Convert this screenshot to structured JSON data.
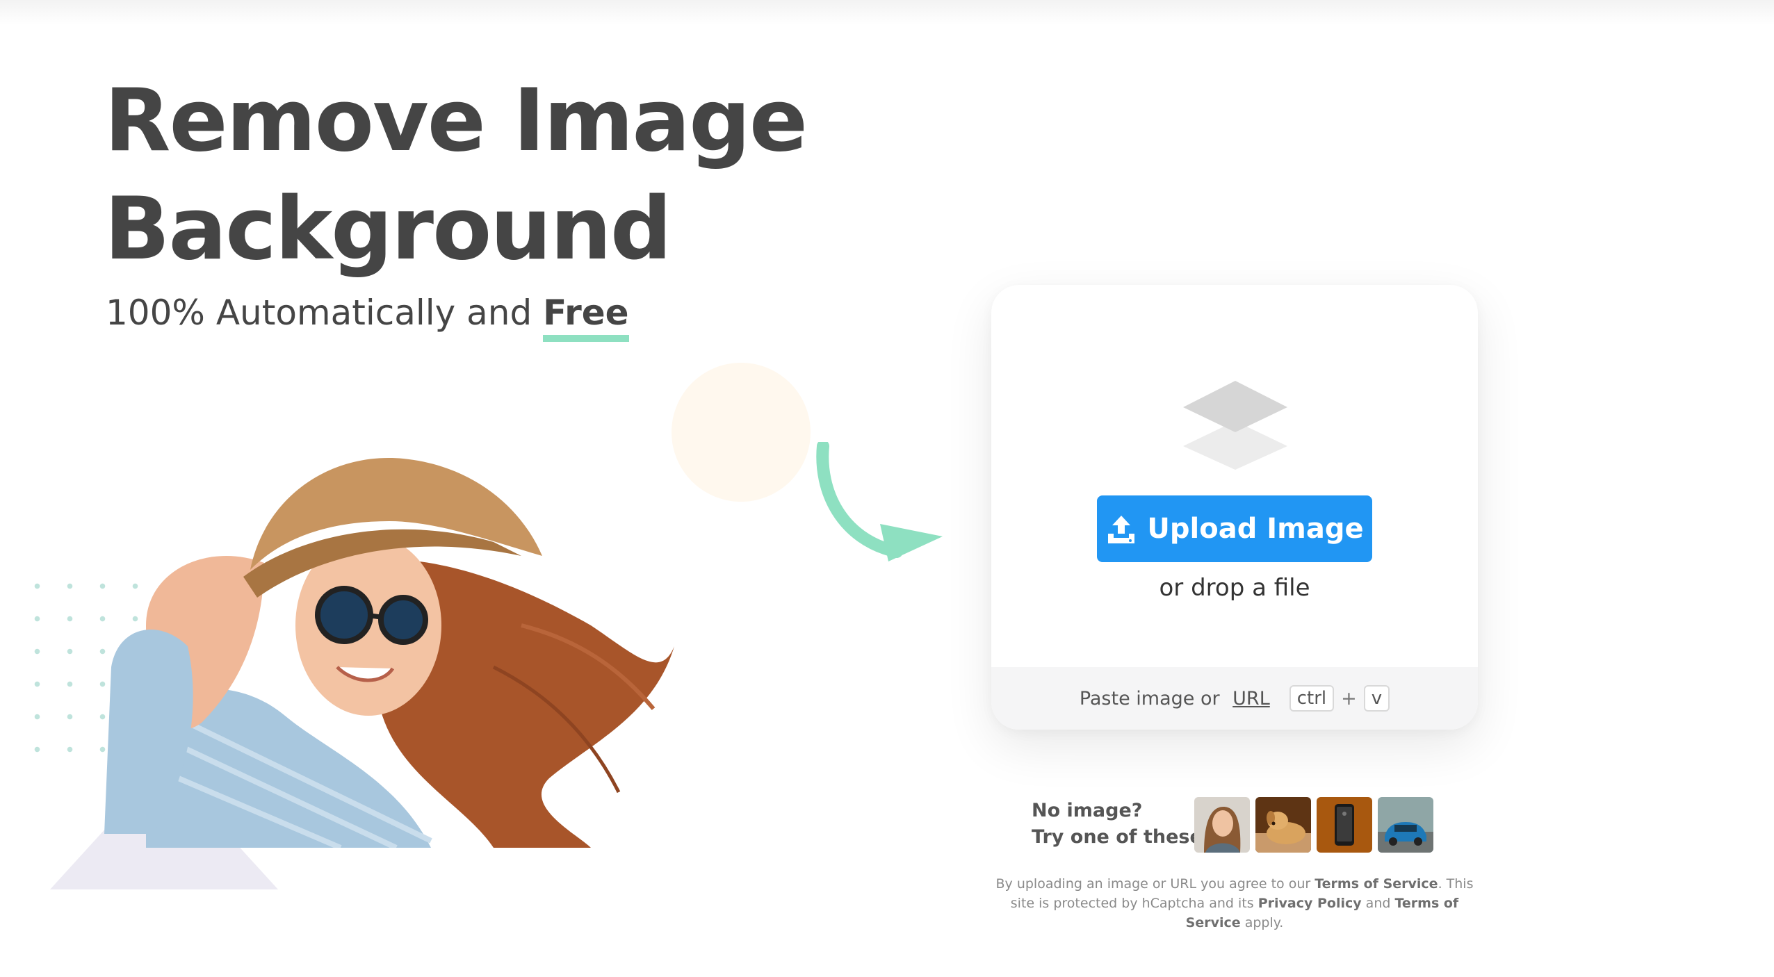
{
  "hero": {
    "title_line1": "Remove Image",
    "title_line2": "Background",
    "subtitle_prefix": "100% Automatically and ",
    "subtitle_highlight": "Free"
  },
  "upload": {
    "button_label": "Upload Image",
    "drop_text": "or drop a file",
    "paste_prefix": "Paste image or ",
    "paste_url_link": "URL",
    "shortcut_key1": "ctrl",
    "shortcut_plus": "+",
    "shortcut_key2": "v"
  },
  "samples": {
    "label_line1": "No image?",
    "label_line2": "Try one of these:",
    "thumbnails": [
      "woman-portrait",
      "golden-retriever",
      "smartphone",
      "blue-car"
    ]
  },
  "legal": {
    "t1": "By uploading an image or URL you agree to our ",
    "terms1": "Terms of Service",
    "t2": ". This site is protected by hCaptcha and its ",
    "privacy": "Privacy Policy",
    "t3": " and ",
    "terms2": "Terms of Service",
    "t4": " apply."
  },
  "colors": {
    "accent_blue": "#2196f3",
    "highlight_green": "#8ee0c1",
    "text_dark": "#454545"
  }
}
